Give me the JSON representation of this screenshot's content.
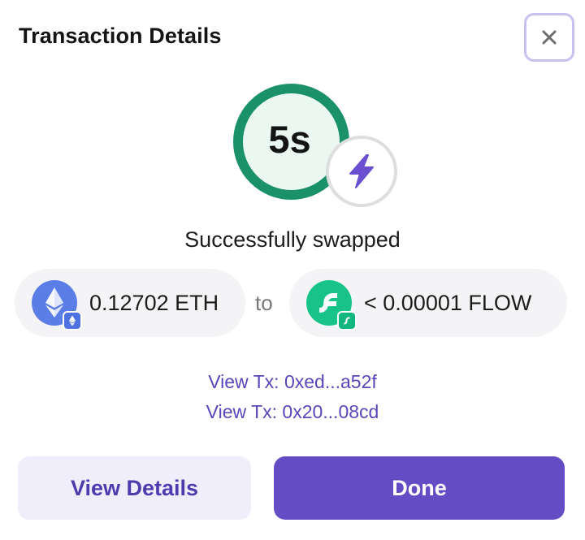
{
  "dialog": {
    "title": "Transaction Details"
  },
  "timer": {
    "label": "5s"
  },
  "status": "Successfully swapped",
  "swap": {
    "from": {
      "amount": "0.12702 ETH",
      "token_icon": "ethereum-icon",
      "chain_badge": "ethereum-chain-icon"
    },
    "connector": "to",
    "to": {
      "amount": "< 0.00001 FLOW",
      "token_icon": "flow-token-icon",
      "chain_badge": "flow-chain-icon"
    }
  },
  "transactions": [
    {
      "label": "View Tx: 0xed...a52f"
    },
    {
      "label": "View Tx: 0x20...08cd"
    }
  ],
  "buttons": {
    "details": "View Details",
    "done": "Done"
  },
  "colors": {
    "accent": "#644cc4",
    "success_ring": "#1a9168",
    "link": "#5a46b8"
  },
  "icons": {
    "close": "close-icon",
    "speed": "lightning-bolt-icon"
  }
}
